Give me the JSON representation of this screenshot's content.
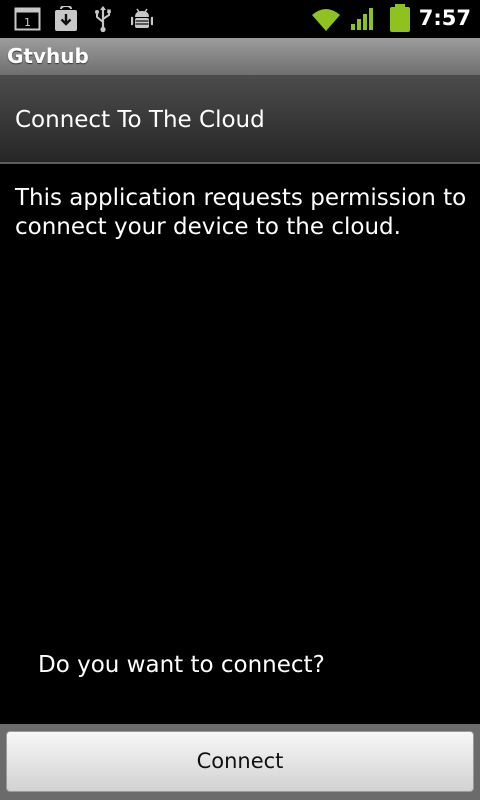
{
  "status_bar": {
    "time": "7:57",
    "calendar_day": "1",
    "icons": [
      "calendar-icon",
      "download-icon",
      "usb-icon",
      "android-debug-icon",
      "wifi-icon",
      "signal-icon",
      "battery-icon"
    ],
    "colors": {
      "status_green": "#8ec31f"
    }
  },
  "app": {
    "title": "Gtvhub"
  },
  "dialog": {
    "header": "Connect To The Cloud",
    "message": "This application requests permission to connect your device to the cloud.",
    "question": "Do you want to connect?",
    "connect_label": "Connect"
  }
}
